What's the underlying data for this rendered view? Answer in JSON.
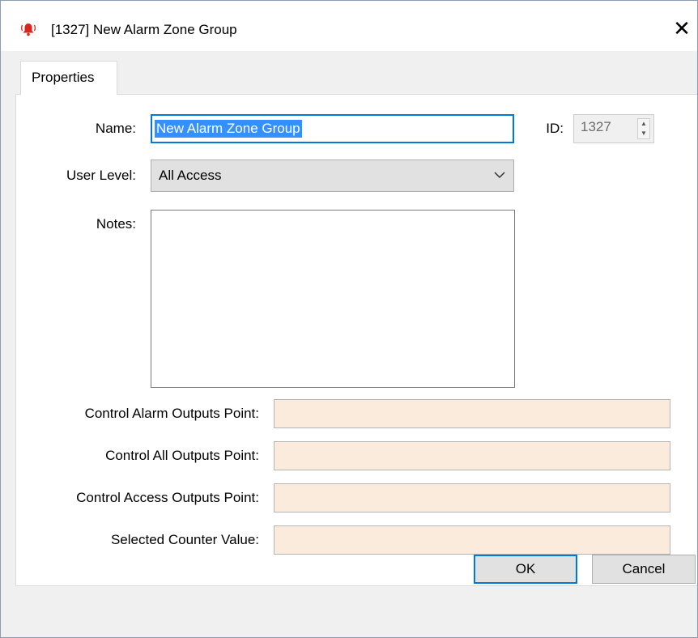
{
  "window": {
    "title": "[1327] New Alarm Zone Group",
    "icon": "alarm-bell-icon",
    "close_glyph": "✕"
  },
  "tabs": [
    {
      "label": "Properties",
      "selected": true
    }
  ],
  "form": {
    "name_label": "Name:",
    "name_value": "New Alarm Zone Group",
    "id_label": "ID:",
    "id_value": "1327",
    "user_level_label": "User Level:",
    "user_level_value": "All Access",
    "notes_label": "Notes:",
    "notes_value": "",
    "control_alarm_outputs_label": "Control Alarm Outputs Point:",
    "control_alarm_outputs_value": "",
    "control_all_outputs_label": "Control All Outputs Point:",
    "control_all_outputs_value": "",
    "control_access_outputs_label": "Control Access Outputs Point:",
    "control_access_outputs_value": "",
    "selected_counter_label": "Selected Counter Value:",
    "selected_counter_value": ""
  },
  "buttons": {
    "ok": "OK",
    "cancel": "Cancel"
  },
  "colors": {
    "accent": "#0078d7",
    "selection": "#3390ff",
    "point_field_bg": "#faebdc"
  }
}
